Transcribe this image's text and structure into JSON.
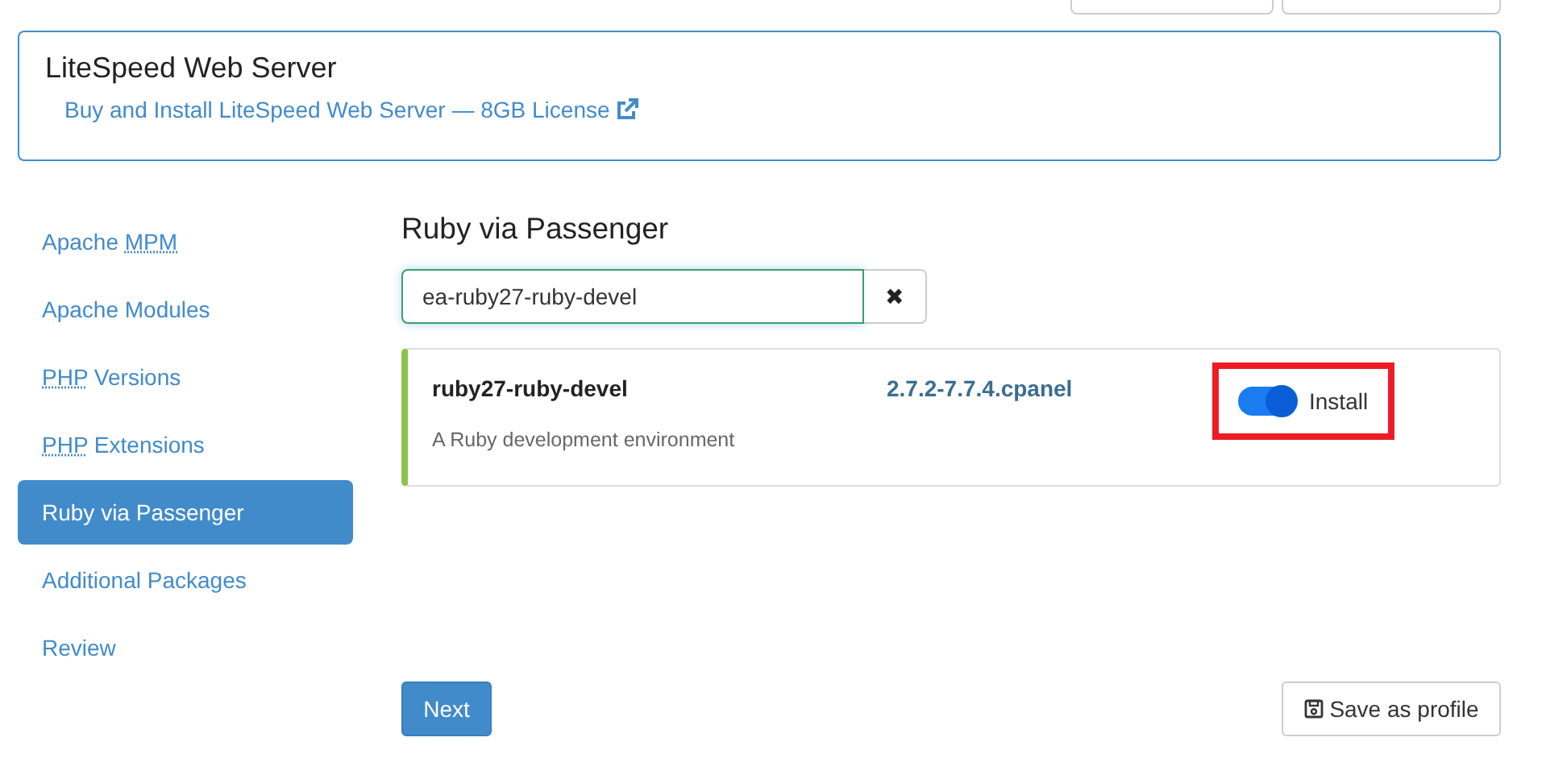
{
  "banner": {
    "title": "LiteSpeed Web Server",
    "link": "Buy and Install LiteSpeed Web Server — 8GB License"
  },
  "sidebar": {
    "items": [
      {
        "parts": [
          {
            "text": "Apache ",
            "abbr": false
          },
          {
            "text": "MPM",
            "abbr": true
          }
        ],
        "selected": false
      },
      {
        "parts": [
          {
            "text": "Apache Modules",
            "abbr": false
          }
        ],
        "selected": false
      },
      {
        "parts": [
          {
            "text": "PHP",
            "abbr": true
          },
          {
            "text": " Versions",
            "abbr": false
          }
        ],
        "selected": false
      },
      {
        "parts": [
          {
            "text": "PHP",
            "abbr": true
          },
          {
            "text": " Extensions",
            "abbr": false
          }
        ],
        "selected": false
      },
      {
        "parts": [
          {
            "text": "Ruby via Passenger",
            "abbr": false
          }
        ],
        "selected": true
      },
      {
        "parts": [
          {
            "text": "Additional Packages",
            "abbr": false
          }
        ],
        "selected": false
      },
      {
        "parts": [
          {
            "text": "Review",
            "abbr": false
          }
        ],
        "selected": false
      }
    ]
  },
  "main": {
    "title": "Ruby via Passenger",
    "search": {
      "value": "ea-ruby27-ruby-devel",
      "clear": "✖"
    },
    "packages": [
      {
        "name": "ruby27-ruby-devel",
        "version": "2.7.2-7.7.4.cpanel",
        "description": "A Ruby development environment",
        "on": true,
        "toggle_label": "Install",
        "highlighted": true
      }
    ]
  },
  "footer": {
    "next": "Next",
    "save": "Save as profile"
  }
}
